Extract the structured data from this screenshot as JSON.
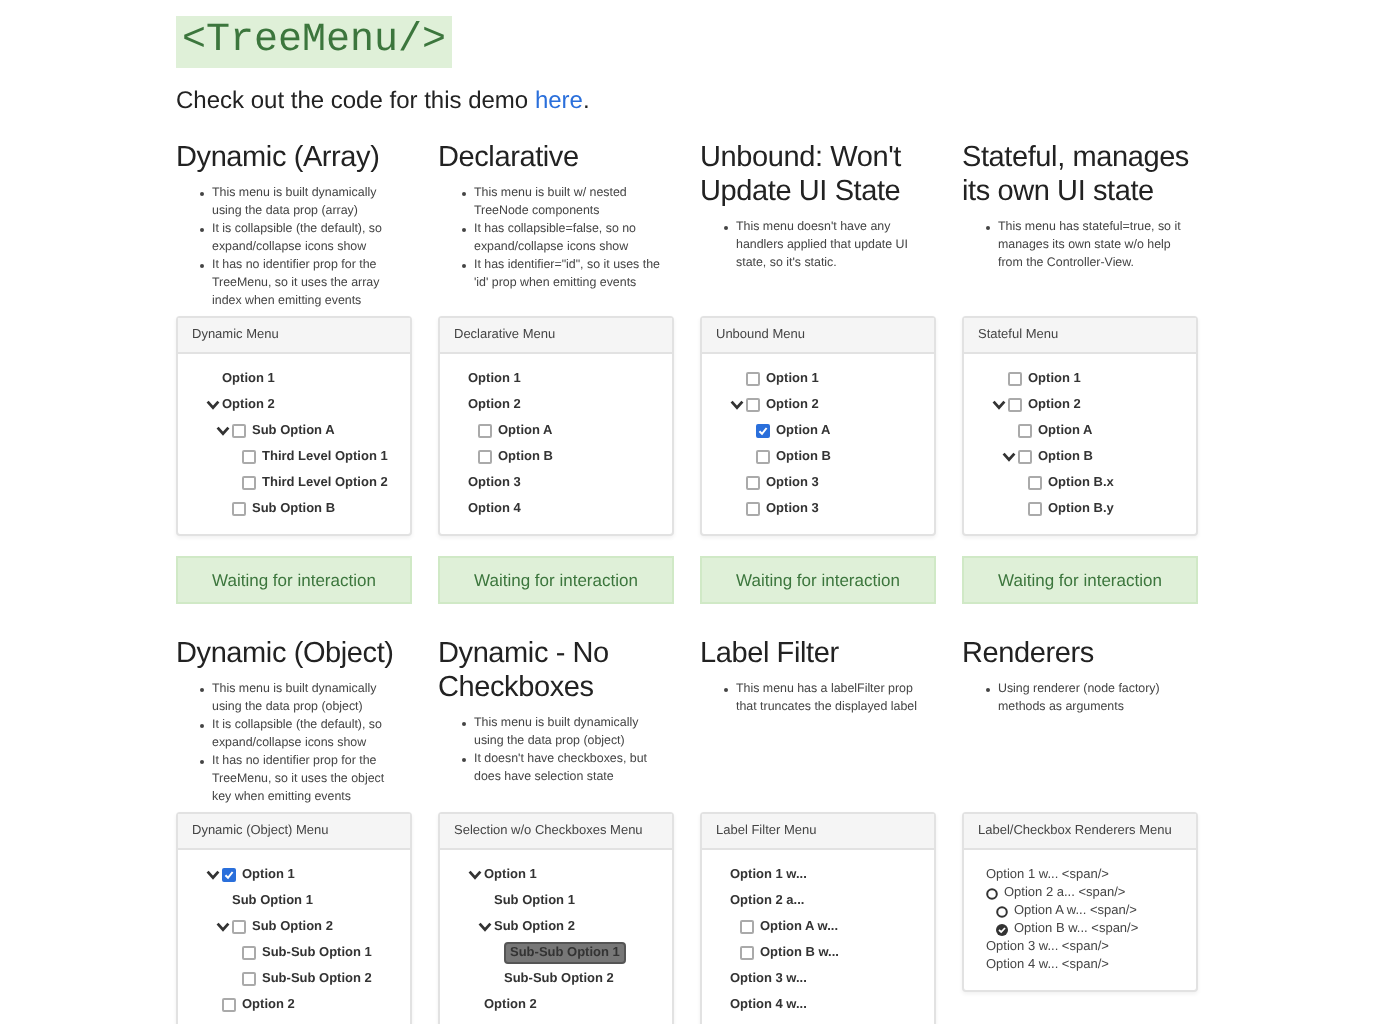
{
  "logo": "<TreeMenu/>",
  "intro": {
    "text": "Check out the code for this demo ",
    "link": "here",
    "end": "."
  },
  "rows": [
    {
      "columns": [
        {
          "title": "Dynamic (Array)",
          "bullets": [
            "This menu is built dynamically using the data prop (array)",
            "It is collapsible (the default), so expand/collapse icons show",
            "It has no identifier prop for the TreeMenu, so it uses the array index when emitting events"
          ],
          "menu": {
            "title": "Dynamic Menu",
            "kind": "tree",
            "collapsible": true,
            "nodes": [
              {
                "label": "Option 1"
              },
              {
                "label": "Option 2",
                "expanded": true,
                "children": [
                  {
                    "label": "Sub Option A",
                    "checkbox": true,
                    "checked": false,
                    "expanded": true,
                    "children": [
                      {
                        "label": "Third Level Option 1",
                        "checkbox": true,
                        "checked": false
                      },
                      {
                        "label": "Third Level Option 2",
                        "checkbox": true,
                        "checked": false
                      }
                    ]
                  },
                  {
                    "label": "Sub Option B",
                    "checkbox": true,
                    "checked": false
                  }
                ]
              }
            ]
          },
          "status": "Waiting for interaction"
        },
        {
          "title": "Declarative",
          "bullets": [
            "This menu is built w/ nested TreeNode components",
            "It has collapsible=false, so no expand/collapse icons show",
            "It has identifier=\"id\", so it uses the 'id' prop when emitting events"
          ],
          "menu": {
            "title": "Declarative Menu",
            "kind": "tree",
            "collapsible": false,
            "nodes": [
              {
                "label": "Option 1"
              },
              {
                "label": "Option 2",
                "children": [
                  {
                    "label": "Option A",
                    "checkbox": true,
                    "checked": false
                  },
                  {
                    "label": "Option B",
                    "checkbox": true,
                    "checked": false
                  }
                ]
              },
              {
                "label": "Option 3"
              },
              {
                "label": "Option 4"
              }
            ]
          },
          "status": "Waiting for interaction"
        },
        {
          "title": "Unbound: Won't Update UI State",
          "bullets": [
            "This menu doesn't have any handlers applied that update UI state, so it's static."
          ],
          "menu": {
            "title": "Unbound Menu",
            "kind": "tree",
            "collapsible": true,
            "nodes": [
              {
                "label": "Option 1",
                "checkbox": true,
                "checked": false
              },
              {
                "label": "Option 2",
                "checkbox": true,
                "checked": false,
                "expanded": true,
                "children": [
                  {
                    "label": "Option A",
                    "checkbox": true,
                    "checked": true
                  },
                  {
                    "label": "Option B",
                    "checkbox": true,
                    "checked": false
                  }
                ]
              },
              {
                "label": "Option 3",
                "checkbox": true,
                "checked": false
              },
              {
                "label": "Option 3",
                "checkbox": true,
                "checked": false
              }
            ]
          },
          "status": "Waiting for interaction"
        },
        {
          "title": "Stateful, manages its own UI state",
          "bullets": [
            "This menu has stateful=true, so it manages its own state w/o help from the Controller-View."
          ],
          "menu": {
            "title": "Stateful Menu",
            "kind": "tree",
            "collapsible": true,
            "nodes": [
              {
                "label": "Option 1",
                "checkbox": true,
                "checked": false
              },
              {
                "label": "Option 2",
                "checkbox": true,
                "checked": false,
                "expanded": true,
                "children": [
                  {
                    "label": "Option A",
                    "checkbox": true,
                    "checked": false
                  },
                  {
                    "label": "Option B",
                    "checkbox": true,
                    "checked": false,
                    "expanded": true,
                    "children": [
                      {
                        "label": "Option B.x",
                        "checkbox": true,
                        "checked": false
                      },
                      {
                        "label": "Option B.y",
                        "checkbox": true,
                        "checked": false
                      }
                    ]
                  }
                ]
              }
            ]
          },
          "status": "Waiting for interaction"
        }
      ]
    },
    {
      "columns": [
        {
          "title": "Dynamic (Object)",
          "bullets": [
            "This menu is built dynamically using the data prop (object)",
            "It is collapsible (the default), so expand/collapse icons show",
            "It has no identifier prop for the TreeMenu, so it uses the object key when emitting events"
          ],
          "menu": {
            "title": "Dynamic (Object) Menu",
            "kind": "tree",
            "collapsible": true,
            "nodes": [
              {
                "label": "Option 1",
                "checkbox": true,
                "checked": true,
                "expanded": true,
                "children": [
                  {
                    "label": "Sub Option 1"
                  },
                  {
                    "label": "Sub Option 2",
                    "checkbox": true,
                    "checked": false,
                    "expanded": true,
                    "children": [
                      {
                        "label": "Sub-Sub Option 1",
                        "checkbox": true,
                        "checked": false
                      },
                      {
                        "label": "Sub-Sub Option 2",
                        "checkbox": true,
                        "checked": false
                      }
                    ]
                  }
                ]
              },
              {
                "label": "Option 2",
                "checkbox": true,
                "checked": false
              }
            ]
          }
        },
        {
          "title": "Dynamic - No Checkboxes",
          "bullets": [
            "This menu is built dynamically using the data prop (object)",
            "It doesn't have checkboxes, but does have selection state"
          ],
          "menu": {
            "title": "Selection w/o Checkboxes Menu",
            "kind": "tree",
            "collapsible": true,
            "nodes": [
              {
                "label": "Option 1",
                "selected": false,
                "expanded": true,
                "children": [
                  {
                    "label": "Sub Option 1",
                    "selected": false
                  },
                  {
                    "label": "Sub Option 2",
                    "selected": false,
                    "expanded": true,
                    "children": [
                      {
                        "label": "Sub-Sub Option 1",
                        "selected": true
                      },
                      {
                        "label": "Sub-Sub Option 2",
                        "selected": false
                      }
                    ]
                  }
                ]
              },
              {
                "label": "Option 2",
                "selected": false
              }
            ]
          }
        },
        {
          "title": "Label Filter",
          "bullets": [
            "This menu has a labelFilter prop that truncates the displayed label"
          ],
          "menu": {
            "title": "Label Filter Menu",
            "kind": "tree",
            "collapsible": false,
            "nodes": [
              {
                "label": "Option 1 w..."
              },
              {
                "label": "Option 2 a...",
                "children": [
                  {
                    "label": "Option A w...",
                    "checkbox": true,
                    "checked": false
                  },
                  {
                    "label": "Option B w...",
                    "checkbox": true,
                    "checked": false
                  }
                ]
              },
              {
                "label": "Option 3 w..."
              },
              {
                "label": "Option 4 w..."
              }
            ]
          }
        },
        {
          "title": "Renderers",
          "bullets": [
            "Using renderer (node factory) methods as arguments"
          ],
          "menu": {
            "title": "Label/Checkbox Renderers Menu",
            "kind": "renderer",
            "collapsible": false,
            "nodes": [
              {
                "label": "Option 1 w... <span/>"
              },
              {
                "label": "Option 2 a... <span/>",
                "radio": true,
                "checked": false,
                "children": [
                  {
                    "label": "Option A w... <span/>",
                    "radio": true,
                    "checked": false
                  },
                  {
                    "label": "Option B w... <span/>",
                    "radio": true,
                    "checked": true
                  }
                ]
              },
              {
                "label": "Option 3 w... <span/>"
              },
              {
                "label": "Option 4 w... <span/>"
              }
            ]
          }
        }
      ]
    }
  ]
}
